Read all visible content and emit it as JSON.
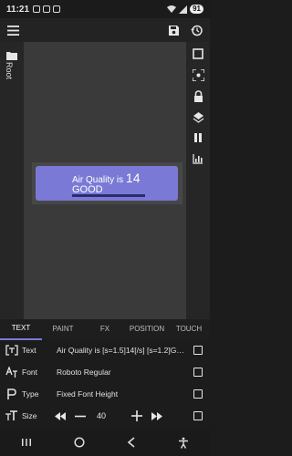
{
  "status_bar": {
    "time": "11:21",
    "battery": "91"
  },
  "left_panel": {
    "root_label": "Root"
  },
  "widget": {
    "line1_prefix": "Air Quality is ",
    "line1_value": "14",
    "line2": "GOOD"
  },
  "tabs": [
    {
      "label": "TEXT",
      "active": true
    },
    {
      "label": "PAINT",
      "active": false
    },
    {
      "label": "FX",
      "active": false
    },
    {
      "label": "POSITION",
      "active": false
    },
    {
      "label": "TOUCH",
      "active": false
    }
  ],
  "properties": {
    "text": {
      "label": "Text",
      "value": "Air Quality is [s=1.5]14[/s] [s=1.2]GOOD..."
    },
    "font": {
      "label": "Font",
      "value": "Roboto Regular"
    },
    "type": {
      "label": "Type",
      "value": "Fixed Font Height"
    },
    "size": {
      "label": "Size",
      "value": "40"
    }
  },
  "icons": [
    "hamburger-icon",
    "save-icon",
    "history-icon",
    "folder-icon",
    "square-icon",
    "focus-icon",
    "lock-icon",
    "layers-icon",
    "pause-icon",
    "chart-icon",
    "text-icon",
    "font-icon",
    "type-icon",
    "size-icon",
    "rewind-icon",
    "minus-icon",
    "plus-icon",
    "fast-forward-icon",
    "recents-icon",
    "home-icon",
    "back-icon",
    "accessibility-icon"
  ],
  "colors": {
    "accent": "#7a7ad6",
    "background": "#1c1c1c"
  }
}
